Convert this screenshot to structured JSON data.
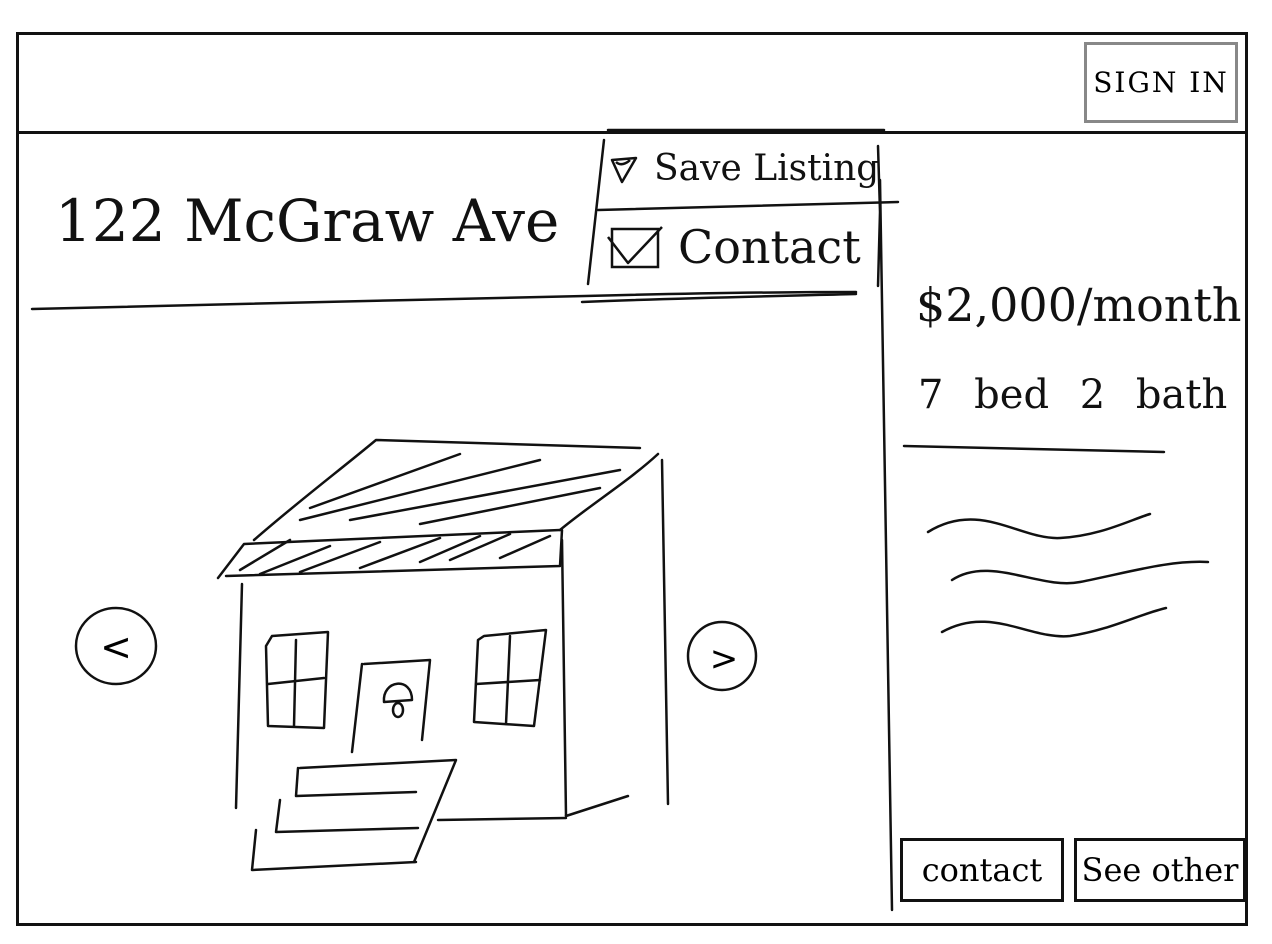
{
  "header": {
    "sign_in_label": "SIGN IN"
  },
  "listing": {
    "address": "122 McGraw Ave",
    "price": "$2,000/month",
    "beds_baths": "7 bed 2 bath"
  },
  "actions_menu": {
    "save_label": "Save Listing",
    "contact_label": "Contact"
  },
  "gallery": {
    "prev_glyph": "<",
    "next_glyph": ">"
  },
  "footer_buttons": {
    "contact_label": "contact",
    "see_other_label": "See other"
  },
  "icons": {
    "save": "heart-icon",
    "contact": "checkbox-icon",
    "prev": "chevron-left-icon",
    "next": "chevron-right-icon"
  },
  "colors": {
    "ink": "#111111",
    "sign_in_border": "#888888",
    "background": "#ffffff"
  }
}
